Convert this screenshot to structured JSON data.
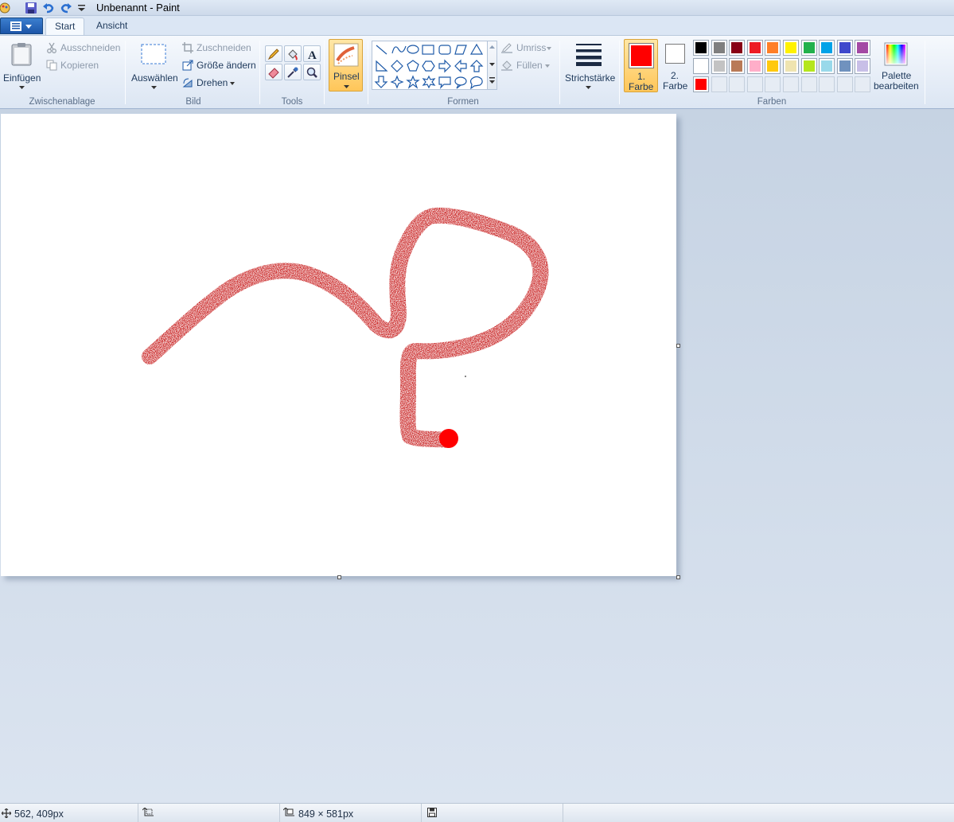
{
  "window": {
    "title": "Unbenannt - Paint"
  },
  "tabs": [
    {
      "label": "Start"
    },
    {
      "label": "Ansicht"
    }
  ],
  "clipboard": {
    "paste": "Einfügen",
    "cut": "Ausschneiden",
    "copy": "Kopieren",
    "group": "Zwischenablage"
  },
  "image": {
    "select": "Auswählen",
    "crop": "Zuschneiden",
    "resize": "Größe ändern",
    "rotate": "Drehen",
    "group": "Bild"
  },
  "tools": {
    "group": "Tools"
  },
  "brush": {
    "label": "Pinsel"
  },
  "shapes": {
    "outline": "Umriss",
    "fill": "Füllen",
    "group": "Formen"
  },
  "stroke": {
    "label": "Strichstärke"
  },
  "colors": {
    "color1_line1": "1.",
    "color1_line2": "Farbe",
    "color2_line1": "2.",
    "color2_line2": "Farbe",
    "edit_line1": "Palette",
    "edit_line2": "bearbeiten",
    "group": "Farben",
    "color1_value": "#ff0000",
    "color2_value": "#ffffff",
    "palette_row1": [
      "#000000",
      "#7f7f7f",
      "#880015",
      "#ed1c24",
      "#ff7f27",
      "#fff200",
      "#22b14c",
      "#00a2e8",
      "#3f48cc",
      "#a349a4"
    ],
    "palette_row2": [
      "#ffffff",
      "#c3c3c3",
      "#b97a57",
      "#ffaec9",
      "#ffc90e",
      "#efe4b0",
      "#b5e61d",
      "#99d9ea",
      "#7092be",
      "#c8bfe7"
    ],
    "palette_row3": [
      "#ff0000",
      "",
      "",
      "",
      "",
      "",
      "",
      "",
      "",
      ""
    ]
  },
  "status": {
    "cursor_pos": "562, 409px",
    "selection_size": "",
    "canvas_size": "849 × 581px"
  },
  "drawing": {
    "stroke_color": "#c00000",
    "dot_color": "#ff0000"
  }
}
